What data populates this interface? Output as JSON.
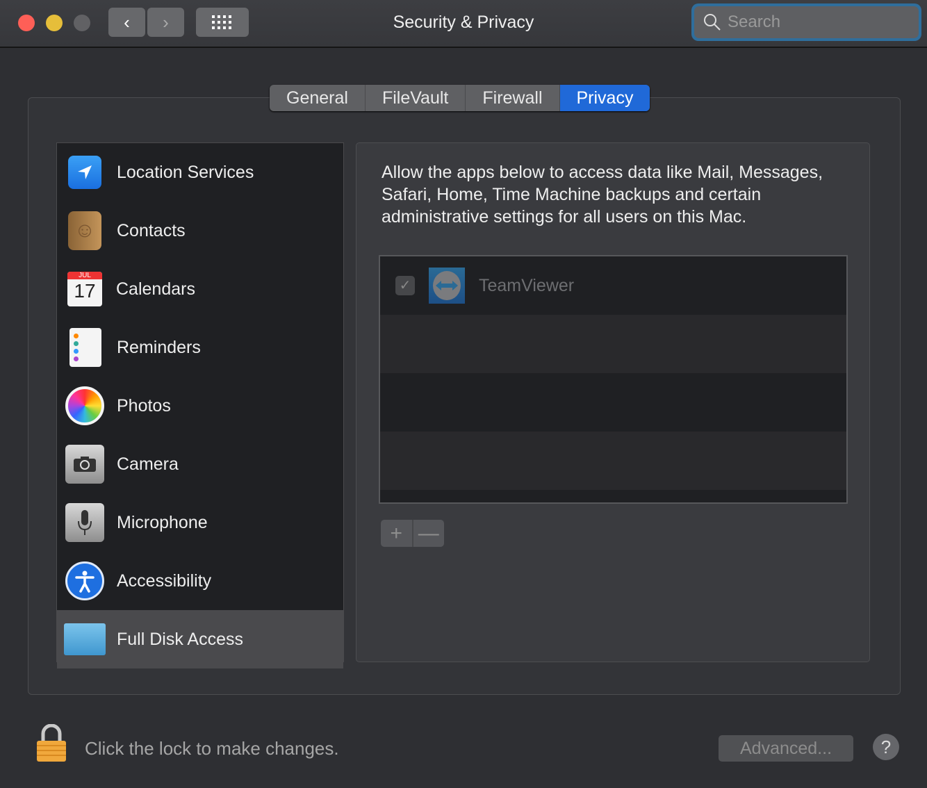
{
  "window": {
    "title": "Security & Privacy",
    "search_placeholder": "Search"
  },
  "toolbar": {
    "back": "‹",
    "forward": "›"
  },
  "tabs": [
    {
      "label": "General"
    },
    {
      "label": "FileVault"
    },
    {
      "label": "Firewall"
    },
    {
      "label": "Privacy",
      "active": true
    }
  ],
  "sidebar": {
    "items": [
      {
        "label": "Location Services",
        "icon": "location-icon"
      },
      {
        "label": "Contacts",
        "icon": "contacts-icon"
      },
      {
        "label": "Calendars",
        "icon": "calendar-icon",
        "month": "JUL",
        "day": "17"
      },
      {
        "label": "Reminders",
        "icon": "reminders-icon"
      },
      {
        "label": "Photos",
        "icon": "photos-icon"
      },
      {
        "label": "Camera",
        "icon": "camera-icon"
      },
      {
        "label": "Microphone",
        "icon": "microphone-icon"
      },
      {
        "label": "Accessibility",
        "icon": "accessibility-icon"
      },
      {
        "label": "Full Disk Access",
        "icon": "folder-icon",
        "selected": true
      }
    ]
  },
  "panel": {
    "description": "Allow the apps below to access data like Mail, Messages, Safari, Home, Time Machine backups and certain administrative settings for all users on this Mac.",
    "apps": [
      {
        "name": "TeamViewer",
        "checked": true
      }
    ]
  },
  "footer": {
    "lock_text": "Click the lock to make changes.",
    "advanced_label": "Advanced...",
    "help_label": "?"
  },
  "colors": {
    "accent": "#2069d8",
    "close": "#fe5f57",
    "minimize": "#e6be3a"
  }
}
